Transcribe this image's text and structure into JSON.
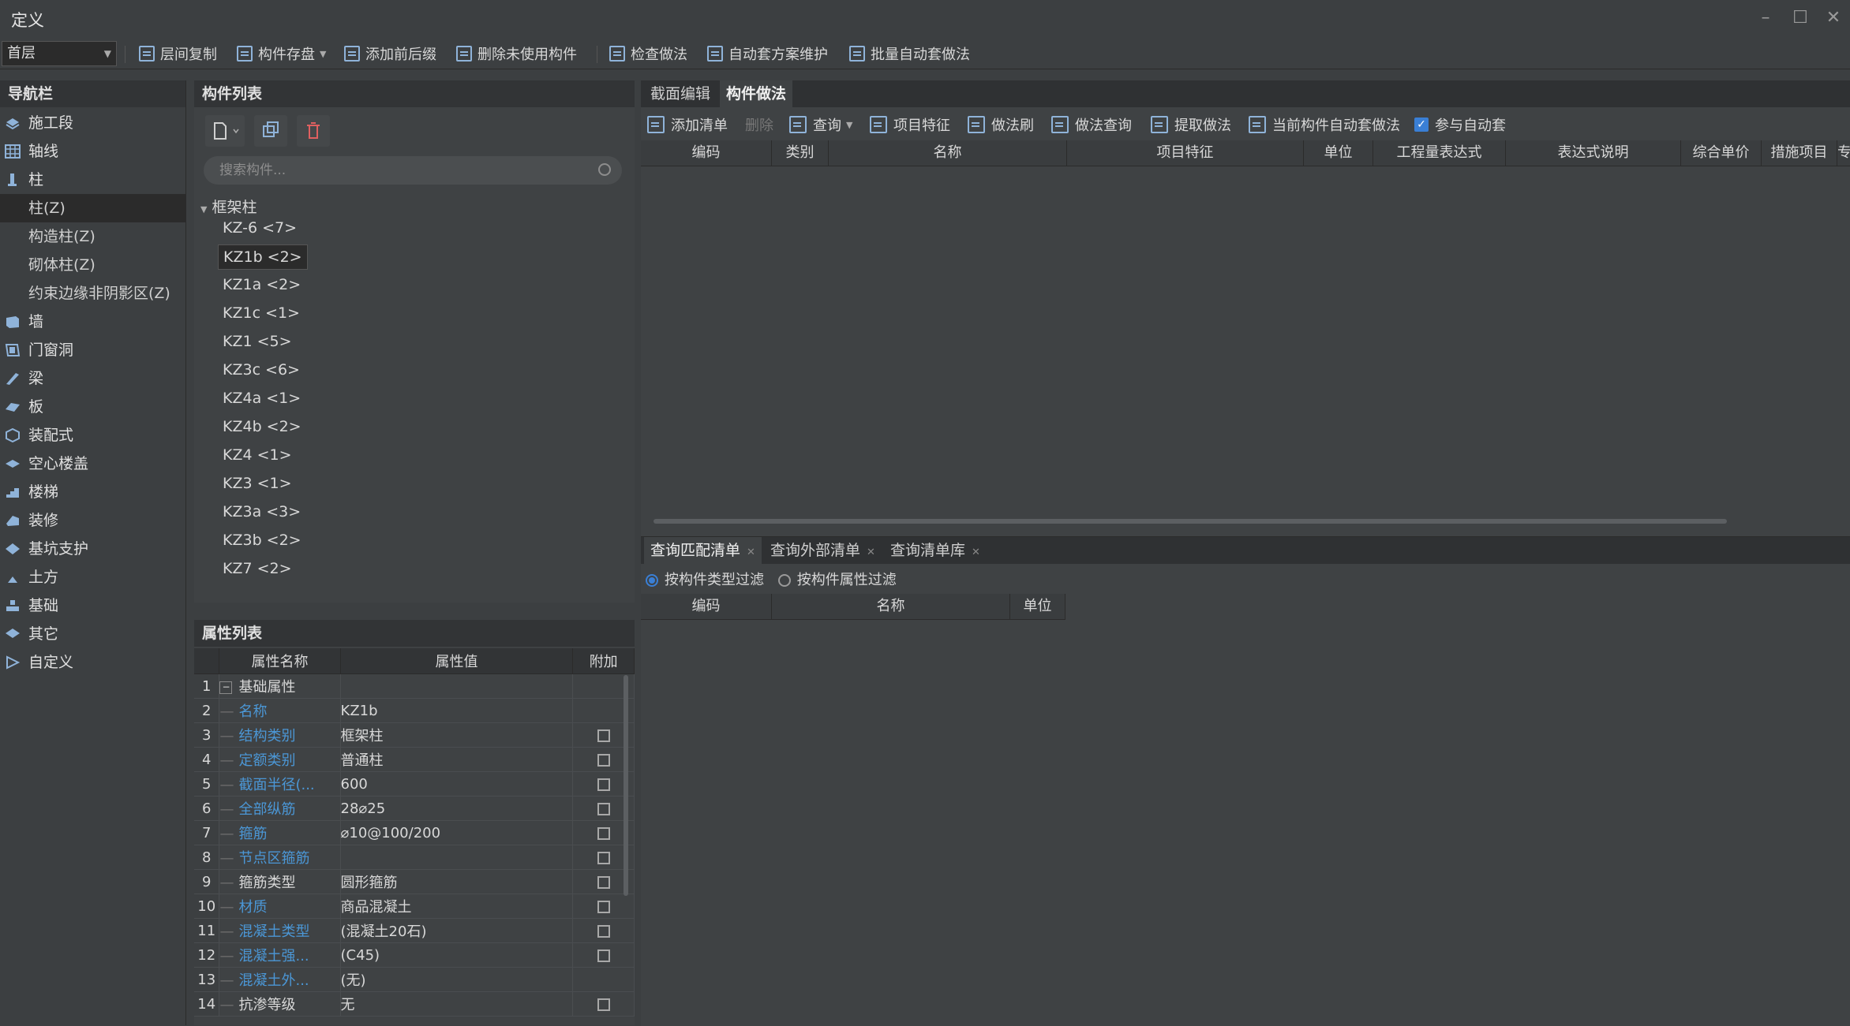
{
  "window": {
    "title": "定义",
    "minimize": "–",
    "maximize": "☐",
    "close": "✕"
  },
  "toolbar": {
    "floor": "首层",
    "items": [
      "层间复制",
      "构件存盘",
      "添加前后缀",
      "删除未使用构件",
      "检查做法",
      "自动套方案维护",
      "批量自动套做法"
    ]
  },
  "nav": {
    "title": "导航栏",
    "items": [
      "施工段",
      "轴线",
      "柱",
      "柱(Z)",
      "构造柱(Z)",
      "砌体柱(Z)",
      "约束边缘非阴影区(Z)",
      "墙",
      "门窗洞",
      "梁",
      "板",
      "装配式",
      "空心楼盖",
      "楼梯",
      "装修",
      "基坑支护",
      "土方",
      "基础",
      "其它",
      "自定义"
    ]
  },
  "components": {
    "title": "构件列表",
    "search_placeholder": "搜索构件...",
    "group": "框架柱",
    "items": [
      "KZ-6 <7>",
      "KZ1b <2>",
      "KZ1a <2>",
      "KZ1c <1>",
      "KZ1 <5>",
      "KZ3c <6>",
      "KZ4a <1>",
      "KZ4b <2>",
      "KZ4 <1>",
      "KZ3 <1>",
      "KZ3a <3>",
      "KZ3b <2>",
      "KZ7 <2>"
    ],
    "selected": "KZ1b <2>"
  },
  "properties": {
    "title": "属性列表",
    "headers": [
      "属性名称",
      "属性值",
      "附加"
    ],
    "rows": [
      {
        "n": "1",
        "name": "基础属性",
        "value": ""
      },
      {
        "n": "2",
        "name": "名称",
        "value": "KZ1b"
      },
      {
        "n": "3",
        "name": "结构类别",
        "value": "框架柱"
      },
      {
        "n": "4",
        "name": "定额类别",
        "value": "普通柱"
      },
      {
        "n": "5",
        "name": "截面半径(...",
        "value": "600"
      },
      {
        "n": "6",
        "name": "全部纵筋",
        "value": "28⌀25"
      },
      {
        "n": "7",
        "name": "箍筋",
        "value": "⌀10@100/200"
      },
      {
        "n": "8",
        "name": "节点区箍筋",
        "value": ""
      },
      {
        "n": "9",
        "name": "箍筋类型",
        "value": "圆形箍筋"
      },
      {
        "n": "10",
        "name": "材质",
        "value": "商品混凝土"
      },
      {
        "n": "11",
        "name": "混凝土类型",
        "value": "(混凝土20石)"
      },
      {
        "n": "12",
        "name": "混凝土强...",
        "value": "(C45)"
      },
      {
        "n": "13",
        "name": "混凝土外...",
        "value": "(无)"
      },
      {
        "n": "14",
        "name": "抗渗等级",
        "value": "无"
      }
    ]
  },
  "right": {
    "tabs": [
      "截面编辑",
      "构件做法"
    ],
    "tools": [
      "添加清单",
      "删除",
      "查询",
      "项目特征",
      "做法刷",
      "做法查询",
      "提取做法",
      "当前构件自动套做法",
      "参与自动套"
    ],
    "grid_headers": [
      "编码",
      "类别",
      "名称",
      "项目特征",
      "单位",
      "工程量表达式",
      "表达式说明",
      "综合单价",
      "措施项目",
      "专"
    ],
    "lower_tabs": [
      "查询匹配清单",
      "查询外部清单",
      "查询清单库"
    ],
    "filters": [
      "按构件类型过滤",
      "按构件属性过滤"
    ],
    "lower_headers": [
      "编码",
      "名称",
      "单位"
    ]
  }
}
